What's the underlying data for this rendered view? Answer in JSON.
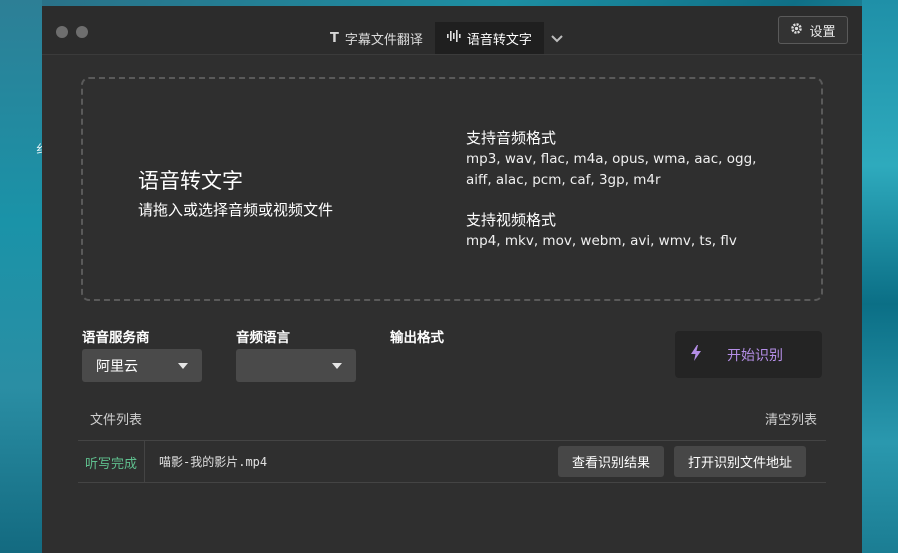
{
  "background": {
    "left_text": "纟"
  },
  "tabs": [
    {
      "label": "字幕文件翻译",
      "icon": "text-T-icon"
    },
    {
      "label": "语音转文字",
      "icon": "audio-wave-icon"
    }
  ],
  "header": {
    "settings_label": "设置"
  },
  "dropzone": {
    "title": "语音转文字",
    "subtitle": "请拖入或选择音频或视频文件",
    "audio_title": "支持音频格式",
    "audio_line1": "mp3, wav, flac, m4a, opus, wma, aac, ogg,",
    "audio_line2": "aiff, alac, pcm, caf, 3gp, m4r",
    "video_title": "支持视频格式",
    "video_line1": "mp4, mkv, mov, webm, avi, wmv, ts, flv"
  },
  "options": {
    "provider_label": "语音服务商",
    "provider_value": "阿里云",
    "language_label": "音频语言",
    "language_value": "",
    "output_label": "输出格式"
  },
  "start_button": "开始识别",
  "file_list": {
    "label": "文件列表",
    "clear_label": "清空列表",
    "rows": [
      {
        "status": "听写完成",
        "filename": "喵影-我的影片.mp4",
        "view_button": "查看识别结果",
        "open_button": "打开识别文件地址"
      }
    ]
  },
  "colors": {
    "accent_purple": "#b48ee6",
    "status_green": "#5fbf8e",
    "window_bg": "#2f2f2f"
  }
}
